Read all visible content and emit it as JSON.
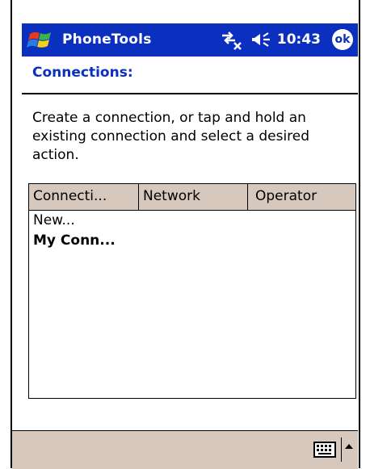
{
  "titlebar": {
    "app_title": "PhoneTools",
    "clock": "10:43",
    "ok_label": "ok"
  },
  "page": {
    "heading": "Connections:",
    "instructions": "Create a connection, or tap and hold an existing connection and select a desired action."
  },
  "list": {
    "columns": [
      "Connecti...",
      "Network",
      "Operator"
    ],
    "rows": [
      {
        "label": "New...",
        "bold": false
      },
      {
        "label": "My Conn...",
        "bold": true
      }
    ]
  },
  "colors": {
    "titlebar": "#0b2fbf",
    "heading": "#0b2fbf",
    "header_bg": "#d6c8bc"
  },
  "icons": {
    "start": "windows-flag-icon",
    "connectivity": "connectivity-icon",
    "volume": "speaker-icon",
    "input": "keyboard-icon",
    "input_menu": "arrow-up-icon"
  }
}
